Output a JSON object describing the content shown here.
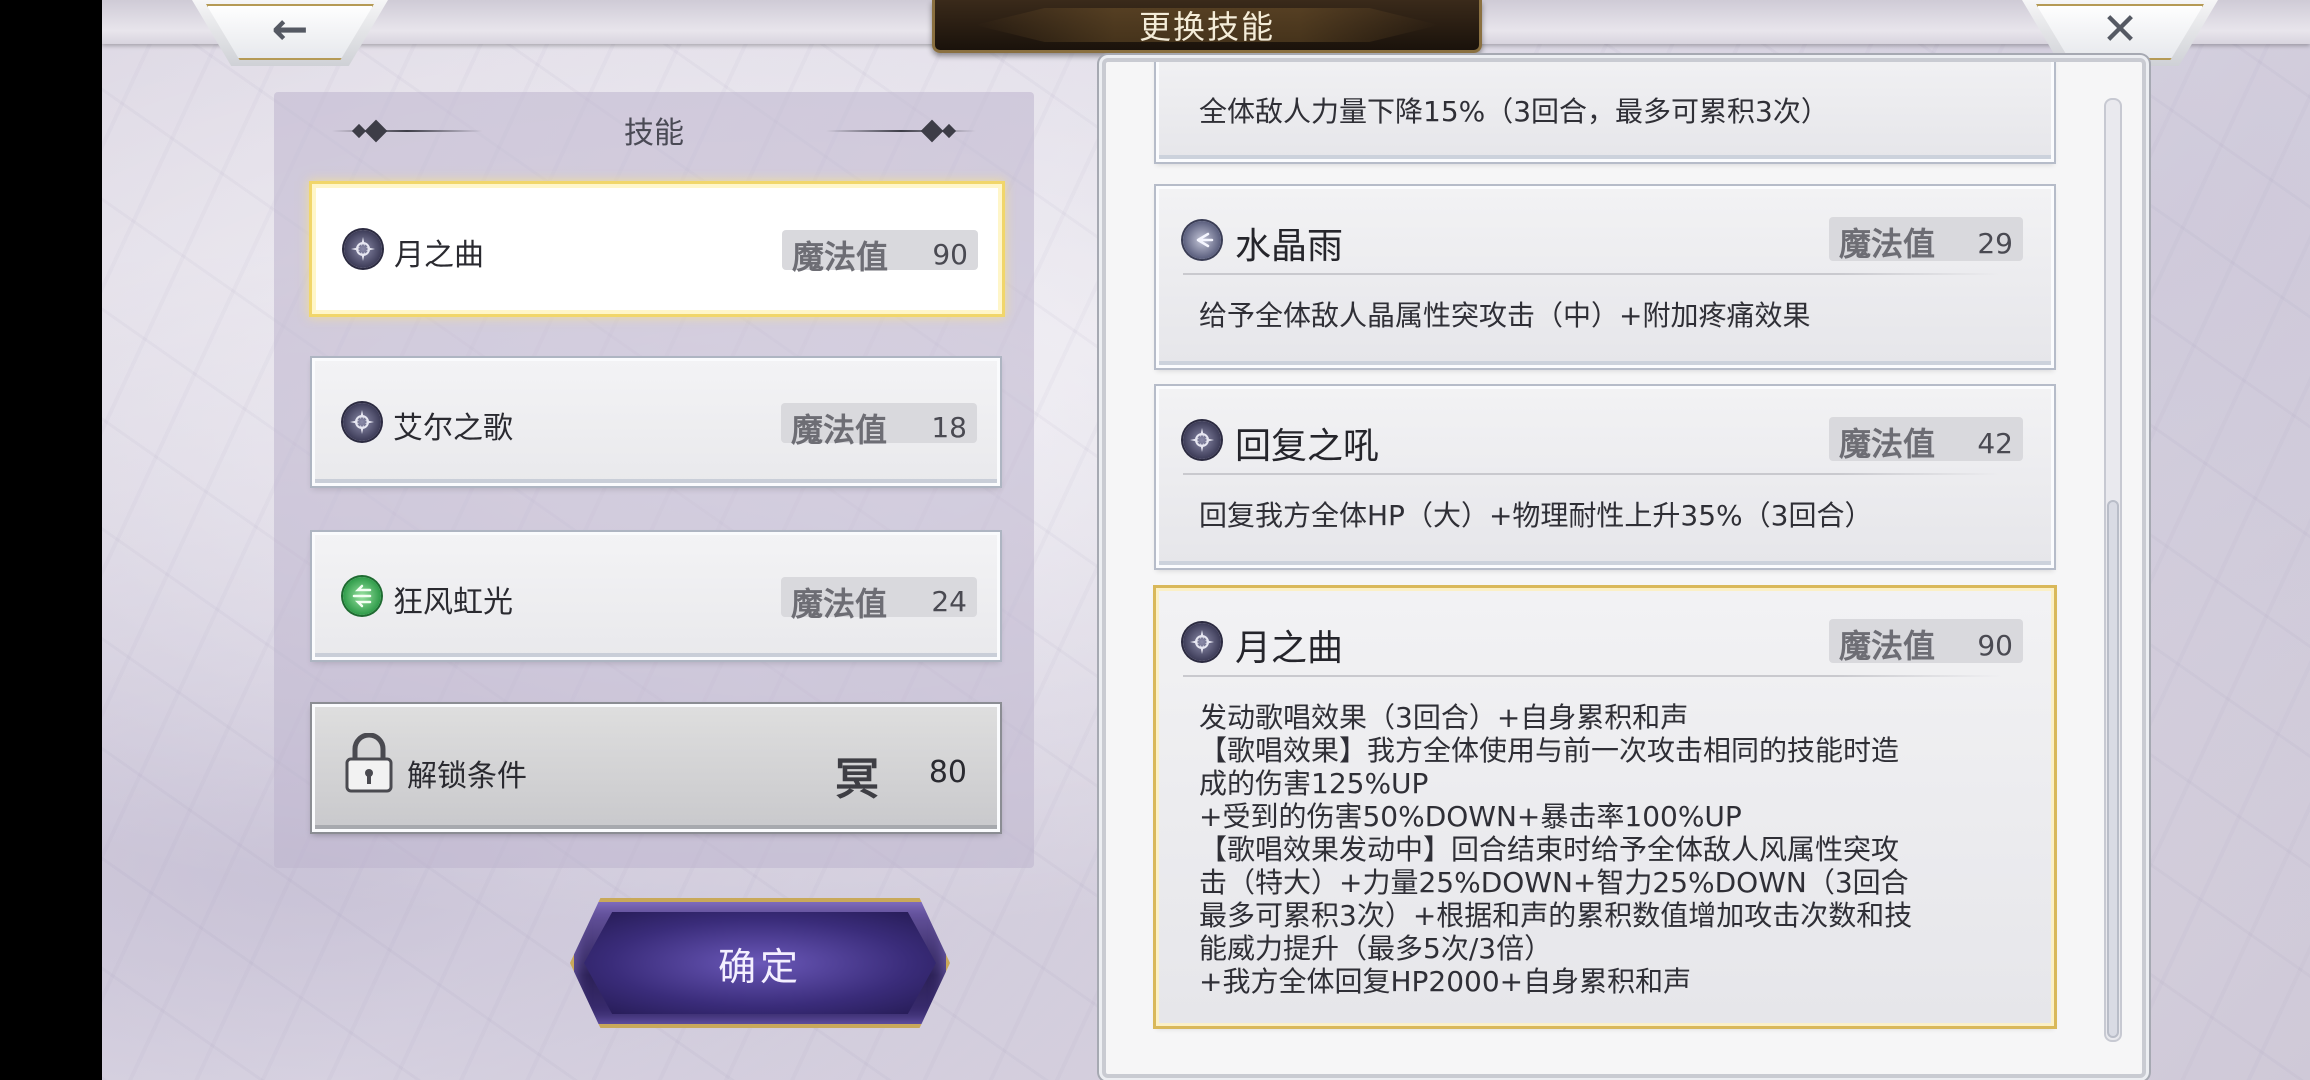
{
  "header": {
    "title": "更换技能",
    "back_icon": "arrow-left-icon",
    "close_icon": "close-icon"
  },
  "left_panel": {
    "title": "技能",
    "skills": [
      {
        "name": "月之曲",
        "mp_label": "魔法值",
        "mp": "90",
        "icon": "moon-skill-icon",
        "selected": true
      },
      {
        "name": "艾尔之歌",
        "mp_label": "魔法值",
        "mp": "18",
        "icon": "moon-skill-icon",
        "selected": false
      },
      {
        "name": "狂风虹光",
        "mp_label": "魔法值",
        "mp": "24",
        "icon": "wind-skill-icon",
        "selected": false
      }
    ],
    "locked_slot": {
      "label": "解锁条件",
      "emblem": "冥",
      "value": "80"
    },
    "confirm_label": "确定"
  },
  "right_panel": {
    "partial_top_desc": "全体敌人力量下降15%（3回合，最多可累积3次）",
    "cards": [
      {
        "name": "水晶雨",
        "mp_label": "魔法值",
        "mp": "29",
        "desc": "给予全体敌人晶属性突攻击（中）+附加疼痛效果"
      },
      {
        "name": "回复之吼",
        "mp_label": "魔法值",
        "mp": "42",
        "desc": "回复我方全体HP（大）+物理耐性上升35%（3回合）"
      },
      {
        "name": "月之曲",
        "mp_label": "魔法值",
        "mp": "90",
        "desc": "发动歌唱效果（3回合）+自身累积和声\n【歌唱效果】我方全体使用与前一次攻击相同的技能时造\n成的伤害125%UP\n+受到的伤害50%DOWN+暴击率100%UP\n【歌唱效果发动中】回合结束时给予全体敌人风属性突攻\n击（特大）+力量25%DOWN+智力25%DOWN（3回合\n最多可累积3次）+根据和声的累积数值增加攻击次数和技\n能威力提升（最多5次/3倍）\n+我方全体回复HP2000+自身累积和声"
      }
    ],
    "scroll_position": 0.6
  }
}
